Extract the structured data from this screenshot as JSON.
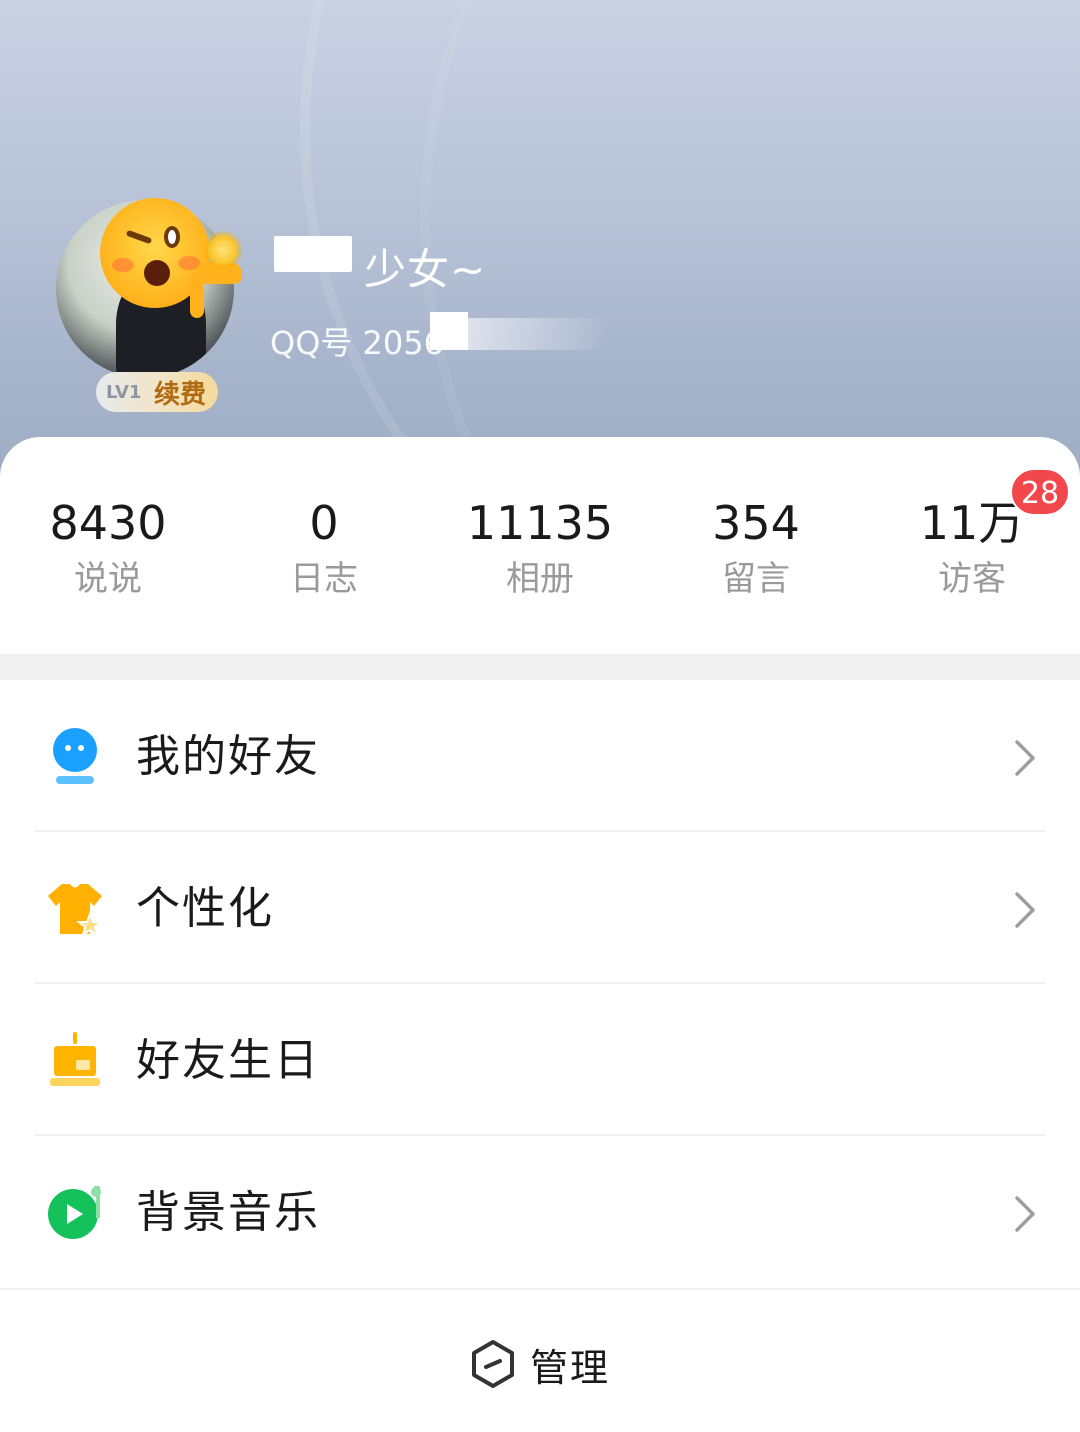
{
  "profile": {
    "nickname": "少女~",
    "qq_label": "QQ号 2056",
    "vip_level": "LV1",
    "renew_label": "续费"
  },
  "stats": [
    {
      "value": "8430",
      "label": "说说"
    },
    {
      "value": "0",
      "label": "日志"
    },
    {
      "value": "11135",
      "label": "相册"
    },
    {
      "value": "354",
      "label": "留言"
    },
    {
      "value": "11万",
      "label": "访客"
    }
  ],
  "visitor_badge": "28",
  "menu": [
    {
      "label": "我的好友",
      "icon": "friends-icon"
    },
    {
      "label": "个性化",
      "icon": "personalize-icon"
    },
    {
      "label": "好友生日",
      "icon": "birthday-cake-icon"
    },
    {
      "label": "背景音乐",
      "icon": "music-icon"
    }
  ],
  "manage_label": "管理",
  "colors": {
    "badge": "#f2474b",
    "friends_icon": "#1aa0ff",
    "personalize_icon": "#ffb000",
    "birthday_icon": "#ffb400",
    "music_icon": "#14c15a"
  }
}
